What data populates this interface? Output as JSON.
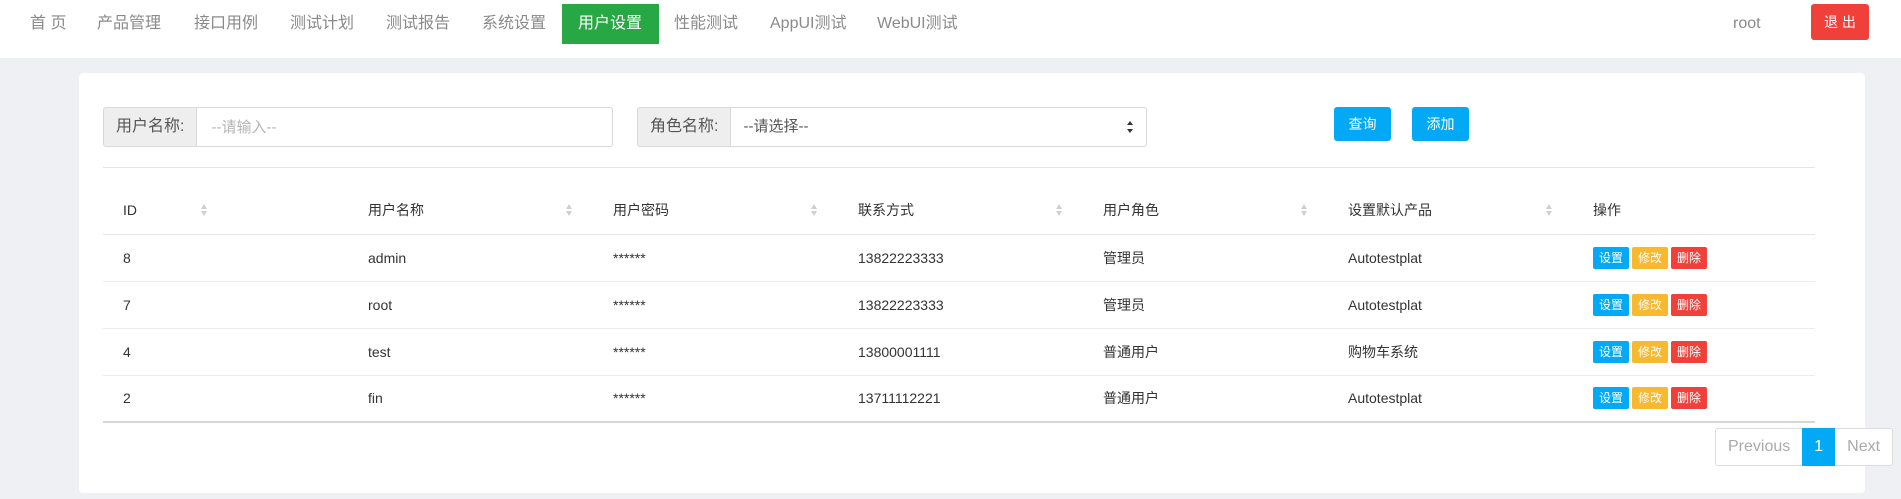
{
  "nav": {
    "items": [
      {
        "label": "首 页"
      },
      {
        "label": "产品管理"
      },
      {
        "label": "接口用例"
      },
      {
        "label": "测试计划"
      },
      {
        "label": "测试报告"
      },
      {
        "label": "系统设置"
      },
      {
        "label": "用户设置",
        "active": true
      },
      {
        "label": "性能测试"
      },
      {
        "label": "AppUI测试"
      },
      {
        "label": "WebUI测试"
      }
    ],
    "user": "root",
    "logout": "退 出",
    "active_color": "#28a745"
  },
  "search": {
    "user_label": "用户名称:",
    "user_placeholder": "--请输入--",
    "role_label": "角色名称:",
    "role_selected": "--请选择--",
    "query_button": "查询",
    "add_button": "添加"
  },
  "table": {
    "headers": [
      "ID",
      "用户名称",
      "用户密码",
      "联系方式",
      "用户角色",
      "设置默认产品",
      "操作"
    ],
    "rows": [
      {
        "id": "8",
        "name": "admin",
        "password": "******",
        "phone": "13822223333",
        "role": "管理员",
        "product": "Autotestplat"
      },
      {
        "id": "7",
        "name": "root",
        "password": "******",
        "phone": "13822223333",
        "role": "管理员",
        "product": "Autotestplat"
      },
      {
        "id": "4",
        "name": "test",
        "password": "******",
        "phone": "13800001111",
        "role": "普通用户",
        "product": "购物车系统"
      },
      {
        "id": "2",
        "name": "fin",
        "password": "******",
        "phone": "13711112221",
        "role": "普通用户",
        "product": "Autotestplat"
      }
    ],
    "actions": {
      "set": "设置",
      "edit": "修改",
      "delete": "删除"
    },
    "colors": {
      "set": "#03a9f4",
      "edit": "#f8b830",
      "delete": "#f0403a"
    }
  },
  "pagination": {
    "previous": "Previous",
    "current": "1",
    "next": "Next"
  }
}
